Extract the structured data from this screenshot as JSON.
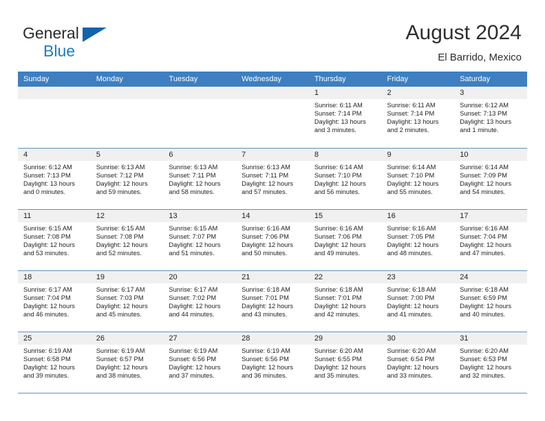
{
  "brand": {
    "word1": "General",
    "word2": "Blue",
    "triangle_color": "#1263ad",
    "blue_color": "#1a7dc4"
  },
  "header": {
    "title": "August 2024",
    "subtitle": "El Barrido, Mexico"
  },
  "theme": {
    "header_bg": "#3d7fc1",
    "daynum_bg": "#f0f0f0",
    "grid_line": "#5b91c7",
    "text": "#1f1f1f"
  },
  "weekday_headers": [
    "Sunday",
    "Monday",
    "Tuesday",
    "Wednesday",
    "Thursday",
    "Friday",
    "Saturday"
  ],
  "labels": {
    "sunrise_prefix": "Sunrise: ",
    "sunset_prefix": "Sunset: ",
    "daylight_prefix": "Daylight: "
  },
  "weeks": [
    [
      {
        "day": "",
        "empty": true
      },
      {
        "day": "",
        "empty": true
      },
      {
        "day": "",
        "empty": true
      },
      {
        "day": "",
        "empty": true
      },
      {
        "day": "1",
        "sunrise": "Sunrise: 6:11 AM",
        "sunset": "Sunset: 7:14 PM",
        "daylight_line1": "Daylight: 13 hours",
        "daylight_line2": "and 3 minutes."
      },
      {
        "day": "2",
        "sunrise": "Sunrise: 6:11 AM",
        "sunset": "Sunset: 7:14 PM",
        "daylight_line1": "Daylight: 13 hours",
        "daylight_line2": "and 2 minutes."
      },
      {
        "day": "3",
        "sunrise": "Sunrise: 6:12 AM",
        "sunset": "Sunset: 7:13 PM",
        "daylight_line1": "Daylight: 13 hours",
        "daylight_line2": "and 1 minute."
      }
    ],
    [
      {
        "day": "4",
        "sunrise": "Sunrise: 6:12 AM",
        "sunset": "Sunset: 7:13 PM",
        "daylight_line1": "Daylight: 13 hours",
        "daylight_line2": "and 0 minutes."
      },
      {
        "day": "5",
        "sunrise": "Sunrise: 6:13 AM",
        "sunset": "Sunset: 7:12 PM",
        "daylight_line1": "Daylight: 12 hours",
        "daylight_line2": "and 59 minutes."
      },
      {
        "day": "6",
        "sunrise": "Sunrise: 6:13 AM",
        "sunset": "Sunset: 7:11 PM",
        "daylight_line1": "Daylight: 12 hours",
        "daylight_line2": "and 58 minutes."
      },
      {
        "day": "7",
        "sunrise": "Sunrise: 6:13 AM",
        "sunset": "Sunset: 7:11 PM",
        "daylight_line1": "Daylight: 12 hours",
        "daylight_line2": "and 57 minutes."
      },
      {
        "day": "8",
        "sunrise": "Sunrise: 6:14 AM",
        "sunset": "Sunset: 7:10 PM",
        "daylight_line1": "Daylight: 12 hours",
        "daylight_line2": "and 56 minutes."
      },
      {
        "day": "9",
        "sunrise": "Sunrise: 6:14 AM",
        "sunset": "Sunset: 7:10 PM",
        "daylight_line1": "Daylight: 12 hours",
        "daylight_line2": "and 55 minutes."
      },
      {
        "day": "10",
        "sunrise": "Sunrise: 6:14 AM",
        "sunset": "Sunset: 7:09 PM",
        "daylight_line1": "Daylight: 12 hours",
        "daylight_line2": "and 54 minutes."
      }
    ],
    [
      {
        "day": "11",
        "sunrise": "Sunrise: 6:15 AM",
        "sunset": "Sunset: 7:08 PM",
        "daylight_line1": "Daylight: 12 hours",
        "daylight_line2": "and 53 minutes."
      },
      {
        "day": "12",
        "sunrise": "Sunrise: 6:15 AM",
        "sunset": "Sunset: 7:08 PM",
        "daylight_line1": "Daylight: 12 hours",
        "daylight_line2": "and 52 minutes."
      },
      {
        "day": "13",
        "sunrise": "Sunrise: 6:15 AM",
        "sunset": "Sunset: 7:07 PM",
        "daylight_line1": "Daylight: 12 hours",
        "daylight_line2": "and 51 minutes."
      },
      {
        "day": "14",
        "sunrise": "Sunrise: 6:16 AM",
        "sunset": "Sunset: 7:06 PM",
        "daylight_line1": "Daylight: 12 hours",
        "daylight_line2": "and 50 minutes."
      },
      {
        "day": "15",
        "sunrise": "Sunrise: 6:16 AM",
        "sunset": "Sunset: 7:06 PM",
        "daylight_line1": "Daylight: 12 hours",
        "daylight_line2": "and 49 minutes."
      },
      {
        "day": "16",
        "sunrise": "Sunrise: 6:16 AM",
        "sunset": "Sunset: 7:05 PM",
        "daylight_line1": "Daylight: 12 hours",
        "daylight_line2": "and 48 minutes."
      },
      {
        "day": "17",
        "sunrise": "Sunrise: 6:16 AM",
        "sunset": "Sunset: 7:04 PM",
        "daylight_line1": "Daylight: 12 hours",
        "daylight_line2": "and 47 minutes."
      }
    ],
    [
      {
        "day": "18",
        "sunrise": "Sunrise: 6:17 AM",
        "sunset": "Sunset: 7:04 PM",
        "daylight_line1": "Daylight: 12 hours",
        "daylight_line2": "and 46 minutes."
      },
      {
        "day": "19",
        "sunrise": "Sunrise: 6:17 AM",
        "sunset": "Sunset: 7:03 PM",
        "daylight_line1": "Daylight: 12 hours",
        "daylight_line2": "and 45 minutes."
      },
      {
        "day": "20",
        "sunrise": "Sunrise: 6:17 AM",
        "sunset": "Sunset: 7:02 PM",
        "daylight_line1": "Daylight: 12 hours",
        "daylight_line2": "and 44 minutes."
      },
      {
        "day": "21",
        "sunrise": "Sunrise: 6:18 AM",
        "sunset": "Sunset: 7:01 PM",
        "daylight_line1": "Daylight: 12 hours",
        "daylight_line2": "and 43 minutes."
      },
      {
        "day": "22",
        "sunrise": "Sunrise: 6:18 AM",
        "sunset": "Sunset: 7:01 PM",
        "daylight_line1": "Daylight: 12 hours",
        "daylight_line2": "and 42 minutes."
      },
      {
        "day": "23",
        "sunrise": "Sunrise: 6:18 AM",
        "sunset": "Sunset: 7:00 PM",
        "daylight_line1": "Daylight: 12 hours",
        "daylight_line2": "and 41 minutes."
      },
      {
        "day": "24",
        "sunrise": "Sunrise: 6:18 AM",
        "sunset": "Sunset: 6:59 PM",
        "daylight_line1": "Daylight: 12 hours",
        "daylight_line2": "and 40 minutes."
      }
    ],
    [
      {
        "day": "25",
        "sunrise": "Sunrise: 6:19 AM",
        "sunset": "Sunset: 6:58 PM",
        "daylight_line1": "Daylight: 12 hours",
        "daylight_line2": "and 39 minutes."
      },
      {
        "day": "26",
        "sunrise": "Sunrise: 6:19 AM",
        "sunset": "Sunset: 6:57 PM",
        "daylight_line1": "Daylight: 12 hours",
        "daylight_line2": "and 38 minutes."
      },
      {
        "day": "27",
        "sunrise": "Sunrise: 6:19 AM",
        "sunset": "Sunset: 6:56 PM",
        "daylight_line1": "Daylight: 12 hours",
        "daylight_line2": "and 37 minutes."
      },
      {
        "day": "28",
        "sunrise": "Sunrise: 6:19 AM",
        "sunset": "Sunset: 6:56 PM",
        "daylight_line1": "Daylight: 12 hours",
        "daylight_line2": "and 36 minutes."
      },
      {
        "day": "29",
        "sunrise": "Sunrise: 6:20 AM",
        "sunset": "Sunset: 6:55 PM",
        "daylight_line1": "Daylight: 12 hours",
        "daylight_line2": "and 35 minutes."
      },
      {
        "day": "30",
        "sunrise": "Sunrise: 6:20 AM",
        "sunset": "Sunset: 6:54 PM",
        "daylight_line1": "Daylight: 12 hours",
        "daylight_line2": "and 33 minutes."
      },
      {
        "day": "31",
        "sunrise": "Sunrise: 6:20 AM",
        "sunset": "Sunset: 6:53 PM",
        "daylight_line1": "Daylight: 12 hours",
        "daylight_line2": "and 32 minutes."
      }
    ]
  ]
}
